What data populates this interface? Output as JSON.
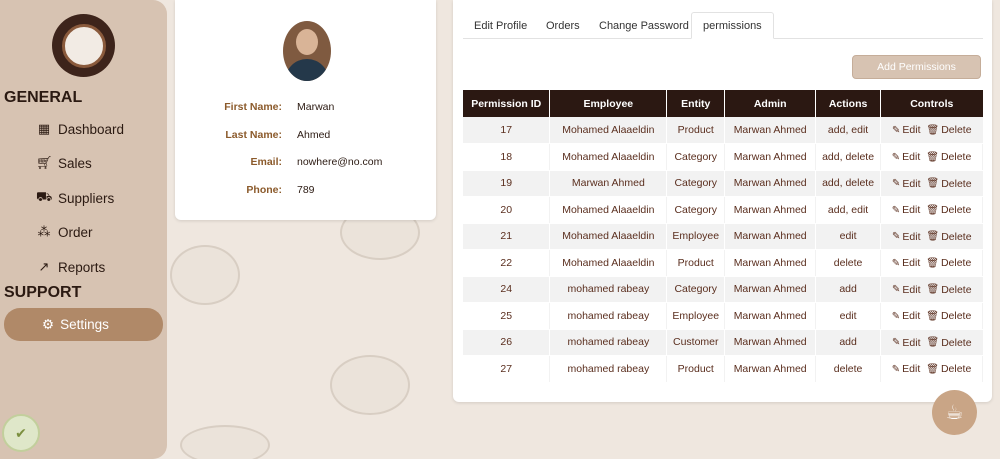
{
  "sidebar": {
    "section_general": "GENERAL",
    "section_support": "SUPPORT",
    "items": [
      {
        "label": "Dashboard",
        "icon": "grid-icon"
      },
      {
        "label": "Sales",
        "icon": "cart-icon"
      },
      {
        "label": "Suppliers",
        "icon": "truck-icon"
      },
      {
        "label": "Order",
        "icon": "coffee-beans-icon"
      },
      {
        "label": "Reports",
        "icon": "line-chart-icon"
      }
    ],
    "active_item": {
      "label": "Settings",
      "icon": "gear-icon"
    }
  },
  "profile": {
    "first_name_label": "First Name:",
    "first_name": "Marwan",
    "last_name_label": "Last Name:",
    "last_name": "Ahmed",
    "email_label": "Email:",
    "email": "nowhere@no.com",
    "phone_label": "Phone:",
    "phone": "789"
  },
  "tabs": [
    {
      "label": "Edit Profile"
    },
    {
      "label": "Orders"
    },
    {
      "label": "Change Password"
    },
    {
      "label": "permissions",
      "active": true
    }
  ],
  "add_button_label": "Add Permissions",
  "table": {
    "headers": [
      "Permission ID",
      "Employee",
      "Entity",
      "Admin",
      "Actions",
      "Controls"
    ],
    "edit_label": "Edit",
    "delete_label": "Delete",
    "rows": [
      {
        "id": "17",
        "employee": "Mohamed Alaaeldin",
        "entity": "Product",
        "admin": "Marwan Ahmed",
        "actions": "add, edit"
      },
      {
        "id": "18",
        "employee": "Mohamed Alaaeldin",
        "entity": "Category",
        "admin": "Marwan Ahmed",
        "actions": "add, delete"
      },
      {
        "id": "19",
        "employee": "Marwan Ahmed",
        "entity": "Category",
        "admin": "Marwan Ahmed",
        "actions": "add, delete"
      },
      {
        "id": "20",
        "employee": "Mohamed Alaaeldin",
        "entity": "Category",
        "admin": "Marwan Ahmed",
        "actions": "add, edit"
      },
      {
        "id": "21",
        "employee": "Mohamed Alaaeldin",
        "entity": "Employee",
        "admin": "Marwan Ahmed",
        "actions": "edit"
      },
      {
        "id": "22",
        "employee": "Mohamed Alaaeldin",
        "entity": "Product",
        "admin": "Marwan Ahmed",
        "actions": "delete"
      },
      {
        "id": "24",
        "employee": "mohamed rabeay",
        "entity": "Category",
        "admin": "Marwan Ahmed",
        "actions": "add"
      },
      {
        "id": "25",
        "employee": "mohamed rabeay",
        "entity": "Employee",
        "admin": "Marwan Ahmed",
        "actions": "edit"
      },
      {
        "id": "26",
        "employee": "mohamed rabeay",
        "entity": "Customer",
        "admin": "Marwan Ahmed",
        "actions": "add"
      },
      {
        "id": "27",
        "employee": "mohamed rabeay",
        "entity": "Product",
        "admin": "Marwan Ahmed",
        "actions": "delete"
      }
    ]
  },
  "colors": {
    "sidebar_bg": "#d7c3b2",
    "active_nav": "#b08968",
    "table_header": "#2b1812",
    "label_brown": "#8b5a2b"
  }
}
